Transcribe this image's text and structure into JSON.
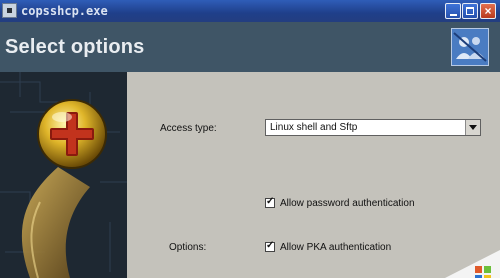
{
  "window": {
    "title": "copsshcp.exe"
  },
  "header": {
    "title": "Select options"
  },
  "form": {
    "access_type_label": "Access type:",
    "access_type_value": "Linux shell and Sftp",
    "options_label": "Options:",
    "checkboxes": [
      {
        "label": "Allow password authentication",
        "checked": true
      },
      {
        "label": "Allow PKA authentication",
        "checked": true
      }
    ]
  },
  "colors": {
    "titlebar": "#2a55b0",
    "header_band": "#3f5566",
    "form_background": "#c4c2bb",
    "art_background": "#1f2933"
  }
}
